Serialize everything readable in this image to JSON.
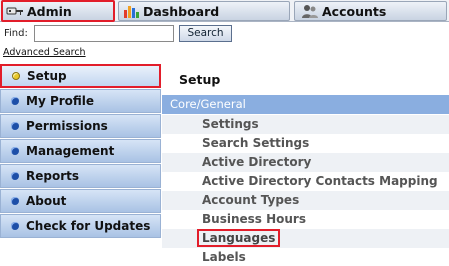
{
  "tabs": [
    {
      "label": "Admin",
      "icon": "key-icon"
    },
    {
      "label": "Dashboard",
      "icon": "bar-chart-icon"
    },
    {
      "label": "Accounts",
      "icon": "people-icon"
    }
  ],
  "find": {
    "label": "Find:",
    "value": "",
    "button": "Search",
    "advanced_link": "Advanced Search"
  },
  "nav": [
    {
      "label": "Setup"
    },
    {
      "label": "My Profile"
    },
    {
      "label": "Permissions"
    },
    {
      "label": "Management"
    },
    {
      "label": "Reports"
    },
    {
      "label": "About"
    },
    {
      "label": "Check for Updates"
    }
  ],
  "content": {
    "title": "Setup",
    "section": "Core/General",
    "items": [
      "Settings",
      "Search Settings",
      "Active Directory",
      "Active Directory Contacts Mapping",
      "Account Types",
      "Business Hours",
      "Languages",
      "Labels"
    ]
  },
  "colors": {
    "highlight": "#e21d2a",
    "section_bar": "#8aaee0",
    "nav_bg": "#a9c2e4"
  }
}
